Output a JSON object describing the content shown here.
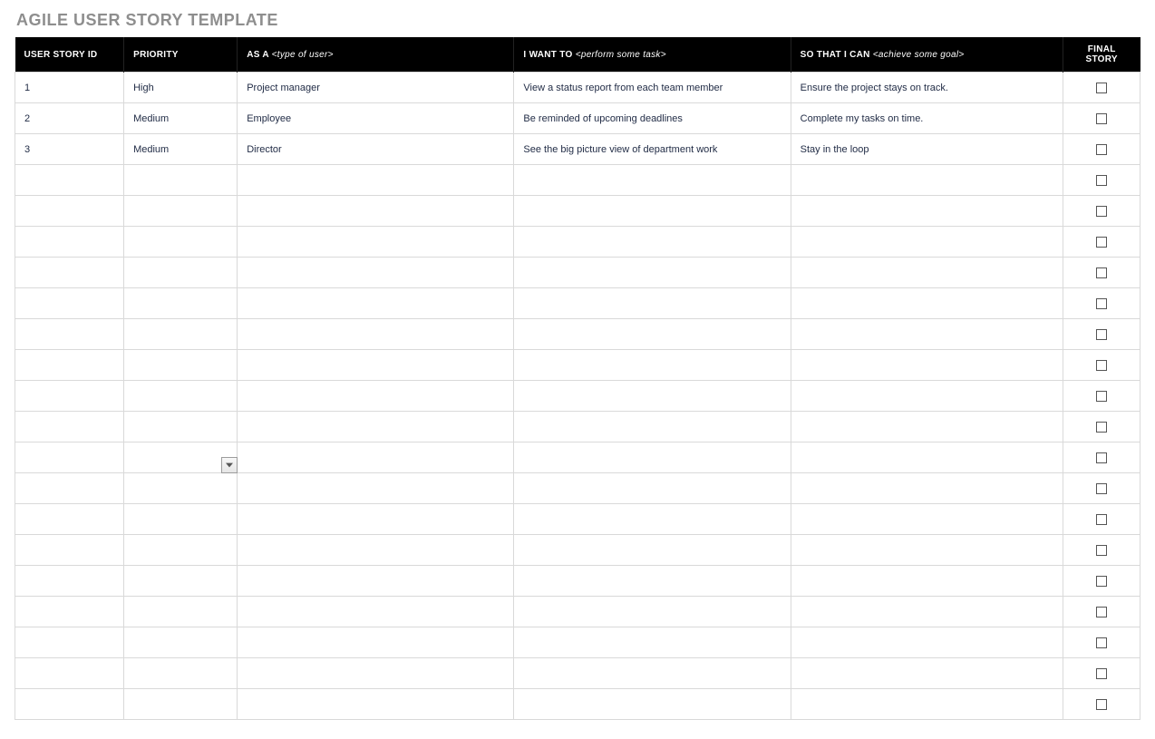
{
  "title": "AGILE USER STORY TEMPLATE",
  "headers": {
    "id": "USER STORY ID",
    "priority": "PRIORITY",
    "as_a_prefix": "AS A ",
    "as_a_hint": "<type of user>",
    "want_prefix": "I WANT TO ",
    "want_hint": "<perform some task>",
    "so_prefix": "SO THAT I CAN ",
    "so_hint": "<achieve some goal>",
    "final": "FINAL STORY"
  },
  "rows": [
    {
      "id": "1",
      "priority": "High",
      "as_a": "Project manager",
      "want": "View a status report from each team member",
      "so": "Ensure the project stays on track.",
      "final": false,
      "dropdown_visible": false
    },
    {
      "id": "2",
      "priority": "Medium",
      "as_a": "Employee",
      "want": "Be reminded of upcoming deadlines",
      "so": "Complete my tasks on time.",
      "final": false,
      "dropdown_visible": false
    },
    {
      "id": "3",
      "priority": "Medium",
      "as_a": "Director",
      "want": "See the big picture view of department work",
      "so": "Stay in the loop",
      "final": false,
      "dropdown_visible": false
    },
    {
      "id": "",
      "priority": "",
      "as_a": "",
      "want": "",
      "so": "",
      "final": false,
      "dropdown_visible": false
    },
    {
      "id": "",
      "priority": "",
      "as_a": "",
      "want": "",
      "so": "",
      "final": false,
      "dropdown_visible": false
    },
    {
      "id": "",
      "priority": "",
      "as_a": "",
      "want": "",
      "so": "",
      "final": false,
      "dropdown_visible": false
    },
    {
      "id": "",
      "priority": "",
      "as_a": "",
      "want": "",
      "so": "",
      "final": false,
      "dropdown_visible": false
    },
    {
      "id": "",
      "priority": "",
      "as_a": "",
      "want": "",
      "so": "",
      "final": false,
      "dropdown_visible": false
    },
    {
      "id": "",
      "priority": "",
      "as_a": "",
      "want": "",
      "so": "",
      "final": false,
      "dropdown_visible": false
    },
    {
      "id": "",
      "priority": "",
      "as_a": "",
      "want": "",
      "so": "",
      "final": false,
      "dropdown_visible": false
    },
    {
      "id": "",
      "priority": "",
      "as_a": "",
      "want": "",
      "so": "",
      "final": false,
      "dropdown_visible": false
    },
    {
      "id": "",
      "priority": "",
      "as_a": "",
      "want": "",
      "so": "",
      "final": false,
      "dropdown_visible": false
    },
    {
      "id": "",
      "priority": "",
      "as_a": "",
      "want": "",
      "so": "",
      "final": false,
      "dropdown_visible": true
    },
    {
      "id": "",
      "priority": "",
      "as_a": "",
      "want": "",
      "so": "",
      "final": false,
      "dropdown_visible": false
    },
    {
      "id": "",
      "priority": "",
      "as_a": "",
      "want": "",
      "so": "",
      "final": false,
      "dropdown_visible": false
    },
    {
      "id": "",
      "priority": "",
      "as_a": "",
      "want": "",
      "so": "",
      "final": false,
      "dropdown_visible": false
    },
    {
      "id": "",
      "priority": "",
      "as_a": "",
      "want": "",
      "so": "",
      "final": false,
      "dropdown_visible": false
    },
    {
      "id": "",
      "priority": "",
      "as_a": "",
      "want": "",
      "so": "",
      "final": false,
      "dropdown_visible": false
    },
    {
      "id": "",
      "priority": "",
      "as_a": "",
      "want": "",
      "so": "",
      "final": false,
      "dropdown_visible": false
    },
    {
      "id": "",
      "priority": "",
      "as_a": "",
      "want": "",
      "so": "",
      "final": false,
      "dropdown_visible": false
    },
    {
      "id": "",
      "priority": "",
      "as_a": "",
      "want": "",
      "so": "",
      "final": false,
      "dropdown_visible": false
    }
  ]
}
